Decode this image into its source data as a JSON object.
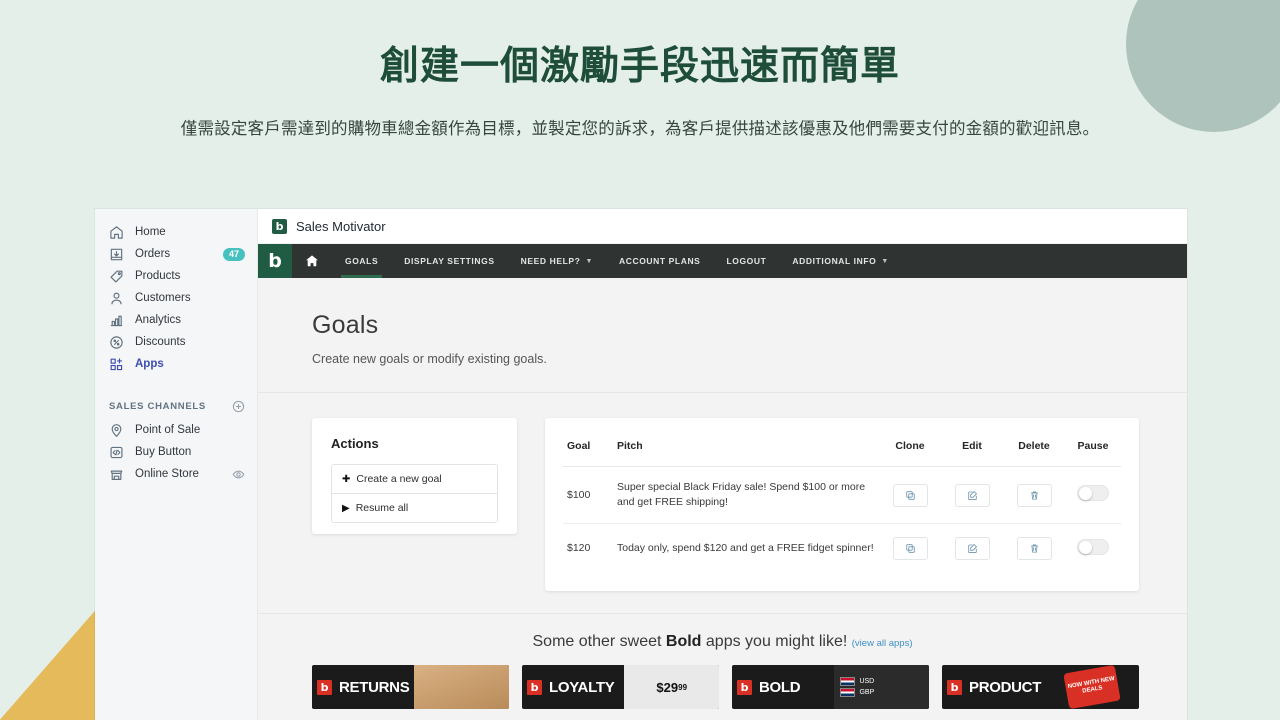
{
  "hero": {
    "title": "創建一個激勵手段迅速而簡單",
    "subtitle": "僅需設定客戶需達到的購物車總金額作為目標，並製定您的訴求，為客戶提供描述該優惠及他們需要支付的金額的歡迎訊息。"
  },
  "colors": {
    "brand_green": "#1f5c43",
    "navbar_dark": "#2f3331",
    "badge_teal": "#47c1bf",
    "active_nav_blue": "#3f4eae",
    "link_blue": "#3d8fc4",
    "decor_circle": "#aec3bb",
    "decor_triangle": "#e5ba5b",
    "page_bg": "#e4efe9"
  },
  "sidebar": {
    "items": [
      {
        "label": "Home",
        "icon": "home-icon",
        "badge": ""
      },
      {
        "label": "Orders",
        "icon": "orders-inbox-icon",
        "badge": "47"
      },
      {
        "label": "Products",
        "icon": "tag-icon",
        "badge": ""
      },
      {
        "label": "Customers",
        "icon": "person-icon",
        "badge": ""
      },
      {
        "label": "Analytics",
        "icon": "bar-chart-icon",
        "badge": ""
      },
      {
        "label": "Discounts",
        "icon": "percent-badge-icon",
        "badge": ""
      },
      {
        "label": "Apps",
        "icon": "apps-grid-plus-icon",
        "badge": ""
      }
    ],
    "section_title": "SALES CHANNELS",
    "channels": [
      {
        "label": "Point of Sale",
        "icon": "location-pin-icon",
        "trailing_icon": ""
      },
      {
        "label": "Buy Button",
        "icon": "code-brackets-icon",
        "trailing_icon": ""
      },
      {
        "label": "Online Store",
        "icon": "storefront-icon",
        "trailing_icon": "eye-icon"
      }
    ]
  },
  "app": {
    "titlebar": {
      "logo_letter": "b",
      "title": "Sales Motivator"
    },
    "navbar": {
      "brand_letter": "b",
      "home_icon": "house-icon",
      "links": [
        {
          "label": "GOALS",
          "active": true,
          "caret": false
        },
        {
          "label": "DISPLAY SETTINGS",
          "active": false,
          "caret": false
        },
        {
          "label": "NEED HELP?",
          "active": false,
          "caret": true
        },
        {
          "label": "ACCOUNT PLANS",
          "active": false,
          "caret": false
        },
        {
          "label": "LOGOUT",
          "active": false,
          "caret": false
        },
        {
          "label": "ADDITIONAL INFO",
          "active": false,
          "caret": true
        }
      ]
    },
    "page": {
      "heading": "Goals",
      "subheading": "Create new goals or modify existing goals."
    },
    "actions": {
      "title": "Actions",
      "items": [
        {
          "glyph": "✚",
          "label": "Create a new goal",
          "icon": "plus-icon"
        },
        {
          "glyph": "▶",
          "label": "Resume all",
          "icon": "play-icon"
        }
      ]
    },
    "goals_table": {
      "columns": [
        "Goal",
        "Pitch",
        "Clone",
        "Edit",
        "Delete",
        "Pause"
      ],
      "rows": [
        {
          "goal": "$100",
          "pitch": "Super special Black Friday sale! Spend $100 or more and get FREE shipping!",
          "paused": false
        },
        {
          "goal": "$120",
          "pitch": "Today only, spend $120 and get a FREE fidget spinner!",
          "paused": false
        }
      ]
    },
    "promo": {
      "text_before": "Some other sweet ",
      "bold_word": "Bold",
      "text_after": " apps you might like!",
      "link": "(view all apps)",
      "banners": [
        {
          "badge": "b",
          "word": "RETURNS",
          "art": "box"
        },
        {
          "badge": "b",
          "word": "LOYALTY",
          "art": "price",
          "price_main": "$29",
          "price_sup": "99"
        },
        {
          "badge": "b",
          "word": "BOLD",
          "art": "flags",
          "flag_labels": [
            "USD",
            "GBP"
          ]
        },
        {
          "badge": "b",
          "word_red": "",
          "word": "PRODUCT",
          "art": "seal",
          "seal_text": "NOW WITH NEW DEALS"
        }
      ]
    }
  }
}
